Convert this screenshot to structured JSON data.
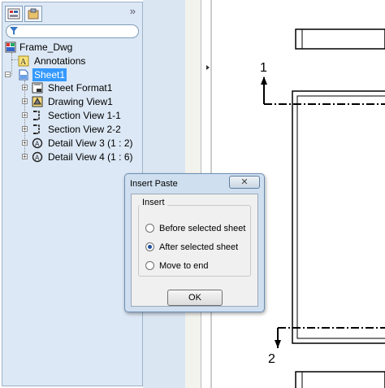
{
  "feature_tree": {
    "filter_icon": "funnel-icon",
    "collapse_glyph": "»",
    "items": [
      {
        "label": "Frame_Dwg",
        "icon": "drawing-icon"
      },
      {
        "label": "Annotations",
        "icon": "annotation-icon"
      },
      {
        "label": "Sheet1",
        "icon": "sheet-icon"
      },
      {
        "label": "Sheet Format1",
        "icon": "sheet-format-icon"
      },
      {
        "label": "Drawing View1",
        "icon": "drawing-view-icon"
      },
      {
        "label": "Section View 1-1",
        "icon": "section-view-icon"
      },
      {
        "label": "Section View 2-2",
        "icon": "section-view-icon"
      },
      {
        "label": "Detail View 3 (1 : 2)",
        "icon": "detail-view-icon"
      },
      {
        "label": "Detail View 4 (1 : 6)",
        "icon": "detail-view-icon"
      }
    ]
  },
  "drawing": {
    "section_label_top": "1",
    "section_label_bottom": "2"
  },
  "dialog": {
    "title": "Insert Paste",
    "close_glyph": "✕",
    "group_label": "Insert",
    "options": [
      {
        "label": "Before selected sheet",
        "selected": false
      },
      {
        "label": "After selected sheet",
        "selected": true
      },
      {
        "label": "Move to end",
        "selected": false
      }
    ],
    "ok_label": "OK"
  },
  "colors": {
    "panel_bg": "#dce8f5",
    "selection_bg": "#3399ff",
    "dialog_frame": "#cfdff0"
  }
}
